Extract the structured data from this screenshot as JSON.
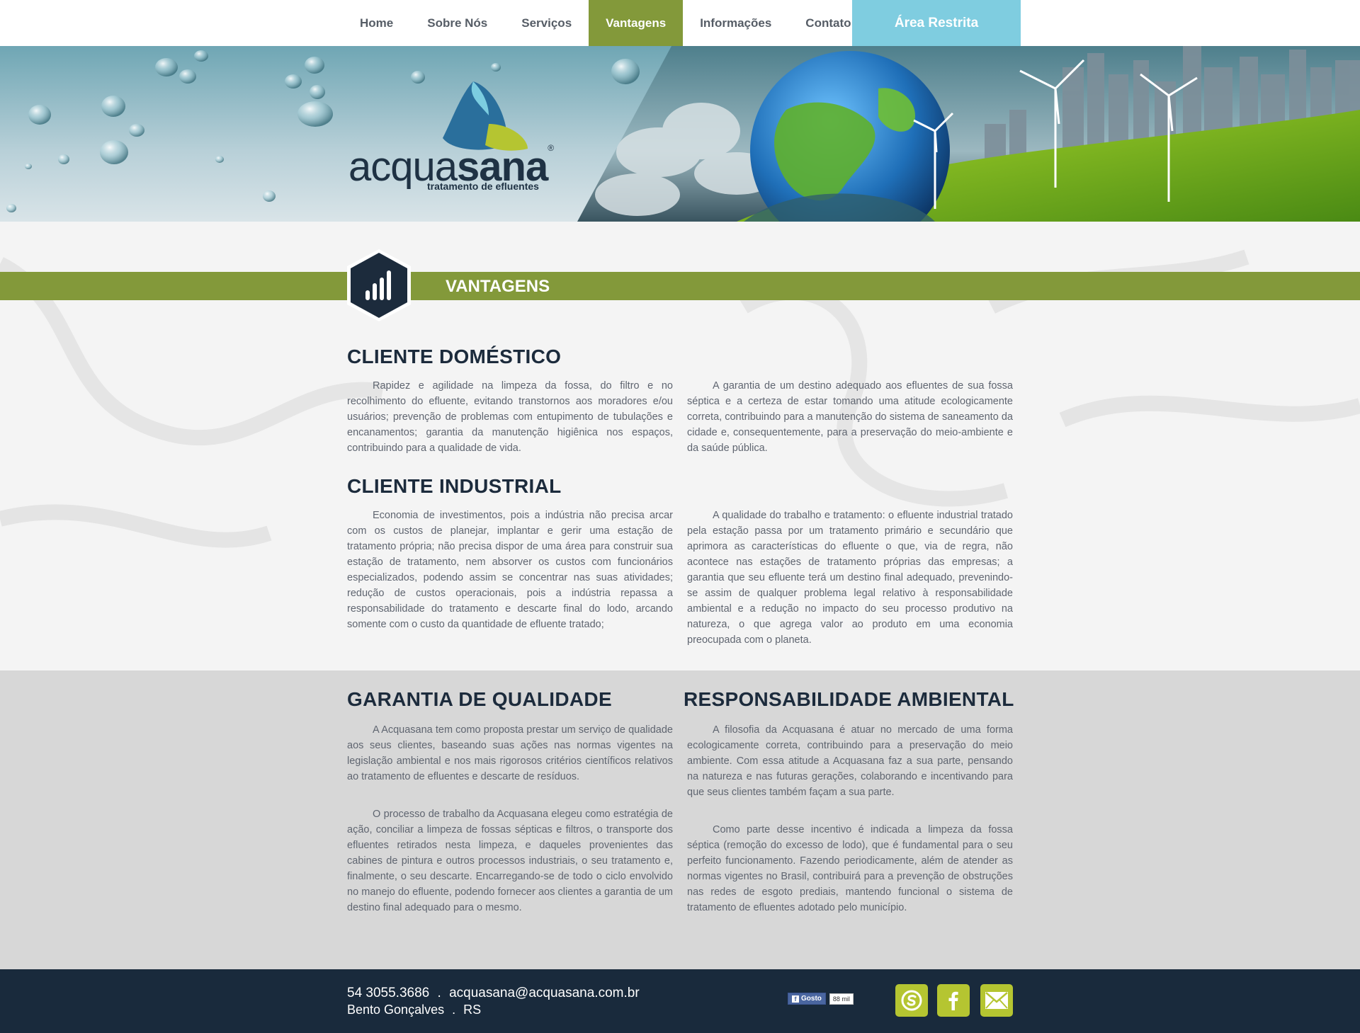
{
  "nav": {
    "items": [
      {
        "label": "Home"
      },
      {
        "label": "Sobre Nós"
      },
      {
        "label": "Serviços"
      },
      {
        "label": "Vantagens",
        "active": true
      },
      {
        "label": "Informações"
      },
      {
        "label": "Contato"
      }
    ],
    "restricted": "Área Restrita"
  },
  "banner": {
    "logo_prefix": "acqua",
    "logo_bold": "sana",
    "logo_reg": "®",
    "logo_sub": "tratamento de efluentes"
  },
  "section": {
    "title": "VANTAGENS",
    "icon": "bar-chart-icon"
  },
  "domestico": {
    "heading": "CLIENTE DOMÉSTICO",
    "left": "Rapidez e agilidade na limpeza da fossa, do filtro e no recolhimento do efluente, evitando transtornos aos moradores e/ou usuários; prevenção de problemas com entupimento de tubulações e encanamentos; garantia da manutenção higiênica nos espaços, contribuindo para a qualidade de vida.",
    "right": "A garantia de um destino adequado aos efluentes de sua fossa séptica e a certeza de estar tomando uma atitude ecologicamente correta, contribuindo para a manutenção do sistema de saneamento da cidade e, consequentemente, para a preservação do meio-ambiente e da saúde pública."
  },
  "industrial": {
    "heading": "CLIENTE INDUSTRIAL",
    "left": "Economia de investimentos, pois a indústria não precisa arcar com os custos de planejar, implantar e gerir uma estação de tratamento própria; não precisa dispor de uma área para construir sua estação de tratamento, nem absorver os custos com funcionários especializados, podendo assim se concentrar nas suas atividades; redução de custos operacionais, pois a indústria repassa a responsabilidade do tratamento e descarte final do lodo, arcando somente com o custo da quantidade de efluente tratado;",
    "right": "A qualidade do trabalho e tratamento: o efluente industrial tratado pela estação passa por um tratamento primário e secundário que aprimora as características do efluente o que, via de regra, não acontece nas estações de tratamento próprias das empresas; a garantia que seu efluente terá um destino final adequado, prevenindo-se assim de qualquer problema legal relativo à responsabilidade ambiental e a redução no impacto do seu processo produtivo na natureza, o que agrega valor ao produto em uma economia preocupada com o planeta."
  },
  "qualidade": {
    "heading": "GARANTIA DE QUALIDADE",
    "p1": "A Acquasana tem como proposta prestar um serviço de qualidade aos seus clientes, baseando suas ações nas normas vigentes na legislação ambiental e nos mais rigorosos critérios científicos relativos ao tratamento de efluentes e descarte de resíduos.",
    "p2": "O processo de trabalho da Acquasana elegeu como estratégia de ação, conciliar a limpeza de fossas sépticas e filtros, o transporte dos efluentes retirados nesta limpeza, e daqueles provenientes das cabines de pintura e outros processos industriais, o seu tratamento e, finalmente, o seu descarte. Encarregando-se de todo o ciclo envolvido no manejo do efluente, podendo fornecer aos clientes a garantia de um destino final adequado para o mesmo."
  },
  "ambiental": {
    "heading": "RESPONSABILIDADE AMBIENTAL",
    "p1": "A filosofia da Acquasana é atuar no mercado de uma forma ecologicamente correta, contribuindo para a preservação do meio ambiente. Com essa atitude a Acquasana faz a sua parte, pensando na natureza e nas futuras gerações, colaborando e incentivando para que seus clientes também façam a sua parte.",
    "p2": "Como parte desse incentivo é indicada a limpeza da fossa séptica (remoção do excesso de lodo), que é fundamental para o seu perfeito funcionamento. Fazendo periodicamente, além de atender as normas vigentes no Brasil, contribuirá para a prevenção de obstruções nas redes de esgoto prediais, mantendo funcional o sistema de tratamento de efluentes adotado pelo município."
  },
  "footer": {
    "phone": "54 3055.3686",
    "sep": ".",
    "email": "acquasana@acquasana.com.br",
    "city": "Bento Gonçalves",
    "state": "RS",
    "fb_label": "Gosto",
    "fb_count": "88 mil",
    "social": [
      "skype-icon",
      "facebook-icon",
      "mail-icon"
    ],
    "accent": "#b5c531"
  },
  "colors": {
    "green": "#83993a",
    "blue_tab": "#7fcde0",
    "navy": "#1c2b3c",
    "footer_bg": "#192a3c"
  }
}
